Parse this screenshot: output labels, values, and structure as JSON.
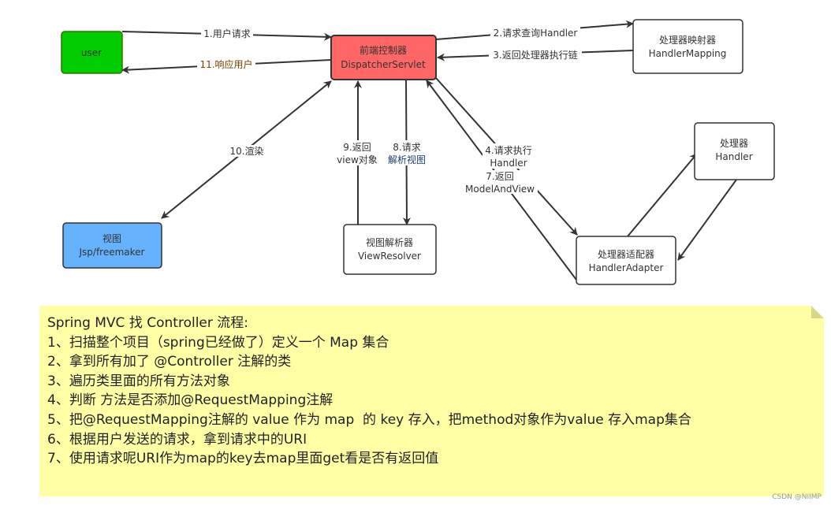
{
  "nodes": {
    "user": {
      "label": "user",
      "color": "#00cc00"
    },
    "dispatcher": {
      "line1": "前端控制器",
      "line2": "DispatcherServlet",
      "color": "#ff6666"
    },
    "handler_mapping": {
      "line1": "处理器映射器",
      "line2": "HandlerMapping"
    },
    "handler": {
      "line1": "处理器",
      "line2": "Handler"
    },
    "handler_adapter": {
      "line1": "处理器适配器",
      "line2": "HandlerAdapter"
    },
    "view_resolver": {
      "line1": "视图解析器",
      "line2": "ViewResolver"
    },
    "view": {
      "line1": "视图",
      "line2": "Jsp/freemaker",
      "color": "#66b2ff"
    }
  },
  "edges": {
    "e1": "1.用户请求",
    "e2": "2.请求查询Handler",
    "e3": "3.返回处理器执行链",
    "e4a": "4.请求执行",
    "e4b": "Handler",
    "e7a": "7.返回",
    "e7b": "ModelAndView",
    "e8a": "8.请求",
    "e8b": "解析视图",
    "e9a": "9.返回",
    "e9b": "view对象",
    "e10": "10.渲染",
    "e11": "11.响应用户"
  },
  "note": {
    "lines": [
      "Spring MVC 找 Controller 流程:",
      "1、扫描整个项目（spring已经做了）定义一个 Map 集合",
      "2、拿到所有加了 @Controller 注解的类",
      "3、遍历类里面的所有方法对象",
      "4、判断 方法是否添加@RequestMapping注解",
      "5、把@RequestMapping注解的 value 作为 map  的 key 存入，把method对象作为value 存入map集合",
      "6、根据用户发送的请求，拿到请求中的URI",
      "7、使用请求呢URI作为map的key去map里面get看是否有返回值"
    ],
    "color": "#ffffa6"
  },
  "watermark": "CSDN @NIIMP"
}
